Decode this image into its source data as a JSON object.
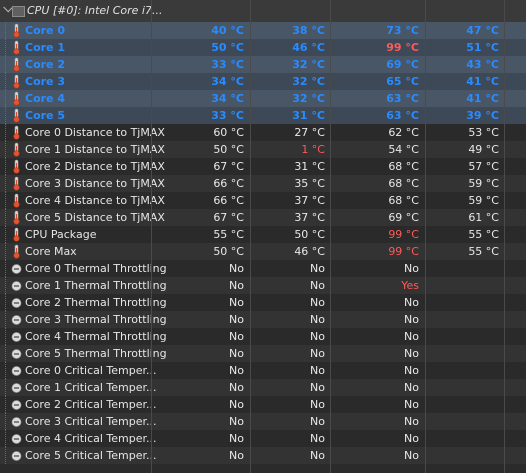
{
  "header": {
    "title": "CPU [#0]: Intel Core i7..."
  },
  "colors": {
    "core_blue": "#2a8bff",
    "hot_red": "#ff5a5a",
    "bg": "#2b2b2b"
  },
  "rows": [
    {
      "name": "Core 0",
      "type": "temp",
      "core": true,
      "v": [
        "40 °C",
        "38 °C",
        "73 °C",
        "47 °C"
      ],
      "hot": [
        false,
        false,
        false,
        false
      ]
    },
    {
      "name": "Core 1",
      "type": "temp",
      "core": true,
      "v": [
        "50 °C",
        "46 °C",
        "99 °C",
        "51 °C"
      ],
      "hot": [
        false,
        false,
        true,
        false
      ]
    },
    {
      "name": "Core 2",
      "type": "temp",
      "core": true,
      "v": [
        "33 °C",
        "32 °C",
        "69 °C",
        "43 °C"
      ],
      "hot": [
        false,
        false,
        false,
        false
      ]
    },
    {
      "name": "Core 3",
      "type": "temp",
      "core": true,
      "v": [
        "34 °C",
        "32 °C",
        "65 °C",
        "41 °C"
      ],
      "hot": [
        false,
        false,
        false,
        false
      ]
    },
    {
      "name": "Core 4",
      "type": "temp",
      "core": true,
      "v": [
        "34 °C",
        "32 °C",
        "63 °C",
        "41 °C"
      ],
      "hot": [
        false,
        false,
        false,
        false
      ]
    },
    {
      "name": "Core 5",
      "type": "temp",
      "core": true,
      "v": [
        "33 °C",
        "31 °C",
        "63 °C",
        "39 °C"
      ],
      "hot": [
        false,
        false,
        false,
        false
      ]
    },
    {
      "name": "Core 0 Distance to TjMAX",
      "type": "temp",
      "core": false,
      "v": [
        "60 °C",
        "27 °C",
        "62 °C",
        "53 °C"
      ],
      "hot": [
        false,
        false,
        false,
        false
      ]
    },
    {
      "name": "Core 1 Distance to TjMAX",
      "type": "temp",
      "core": false,
      "v": [
        "50 °C",
        "1 °C",
        "54 °C",
        "49 °C"
      ],
      "hot": [
        false,
        true,
        false,
        false
      ]
    },
    {
      "name": "Core 2 Distance to TjMAX",
      "type": "temp",
      "core": false,
      "v": [
        "67 °C",
        "31 °C",
        "68 °C",
        "57 °C"
      ],
      "hot": [
        false,
        false,
        false,
        false
      ]
    },
    {
      "name": "Core 3 Distance to TjMAX",
      "type": "temp",
      "core": false,
      "v": [
        "66 °C",
        "35 °C",
        "68 °C",
        "59 °C"
      ],
      "hot": [
        false,
        false,
        false,
        false
      ]
    },
    {
      "name": "Core 4 Distance to TjMAX",
      "type": "temp",
      "core": false,
      "v": [
        "66 °C",
        "37 °C",
        "68 °C",
        "59 °C"
      ],
      "hot": [
        false,
        false,
        false,
        false
      ]
    },
    {
      "name": "Core 5 Distance to TjMAX",
      "type": "temp",
      "core": false,
      "v": [
        "67 °C",
        "37 °C",
        "69 °C",
        "61 °C"
      ],
      "hot": [
        false,
        false,
        false,
        false
      ]
    },
    {
      "name": "CPU Package",
      "type": "temp",
      "core": false,
      "v": [
        "55 °C",
        "50 °C",
        "99 °C",
        "55 °C"
      ],
      "hot": [
        false,
        false,
        true,
        false
      ]
    },
    {
      "name": "Core Max",
      "type": "temp",
      "core": false,
      "v": [
        "50 °C",
        "46 °C",
        "99 °C",
        "55 °C"
      ],
      "hot": [
        false,
        false,
        true,
        false
      ]
    },
    {
      "name": "Core 0 Thermal Throttling",
      "type": "status",
      "core": false,
      "v": [
        "No",
        "No",
        "No",
        ""
      ],
      "hot": [
        false,
        false,
        false,
        false
      ]
    },
    {
      "name": "Core 1 Thermal Throttling",
      "type": "status",
      "core": false,
      "v": [
        "No",
        "No",
        "Yes",
        ""
      ],
      "hot": [
        false,
        false,
        true,
        false
      ]
    },
    {
      "name": "Core 2 Thermal Throttling",
      "type": "status",
      "core": false,
      "v": [
        "No",
        "No",
        "No",
        ""
      ],
      "hot": [
        false,
        false,
        false,
        false
      ]
    },
    {
      "name": "Core 3 Thermal Throttling",
      "type": "status",
      "core": false,
      "v": [
        "No",
        "No",
        "No",
        ""
      ],
      "hot": [
        false,
        false,
        false,
        false
      ]
    },
    {
      "name": "Core 4 Thermal Throttling",
      "type": "status",
      "core": false,
      "v": [
        "No",
        "No",
        "No",
        ""
      ],
      "hot": [
        false,
        false,
        false,
        false
      ]
    },
    {
      "name": "Core 5 Thermal Throttling",
      "type": "status",
      "core": false,
      "v": [
        "No",
        "No",
        "No",
        ""
      ],
      "hot": [
        false,
        false,
        false,
        false
      ]
    },
    {
      "name": "Core 0 Critical Temper...",
      "type": "status",
      "core": false,
      "v": [
        "No",
        "No",
        "No",
        ""
      ],
      "hot": [
        false,
        false,
        false,
        false
      ]
    },
    {
      "name": "Core 1 Critical Temper...",
      "type": "status",
      "core": false,
      "v": [
        "No",
        "No",
        "No",
        ""
      ],
      "hot": [
        false,
        false,
        false,
        false
      ]
    },
    {
      "name": "Core 2 Critical Temper...",
      "type": "status",
      "core": false,
      "v": [
        "No",
        "No",
        "No",
        ""
      ],
      "hot": [
        false,
        false,
        false,
        false
      ]
    },
    {
      "name": "Core 3 Critical Temper...",
      "type": "status",
      "core": false,
      "v": [
        "No",
        "No",
        "No",
        ""
      ],
      "hot": [
        false,
        false,
        false,
        false
      ]
    },
    {
      "name": "Core 4 Critical Temper...",
      "type": "status",
      "core": false,
      "v": [
        "No",
        "No",
        "No",
        ""
      ],
      "hot": [
        false,
        false,
        false,
        false
      ]
    },
    {
      "name": "Core 5 Critical Temper...",
      "type": "status",
      "core": false,
      "v": [
        "No",
        "No",
        "No",
        ""
      ],
      "hot": [
        false,
        false,
        false,
        false
      ]
    }
  ]
}
